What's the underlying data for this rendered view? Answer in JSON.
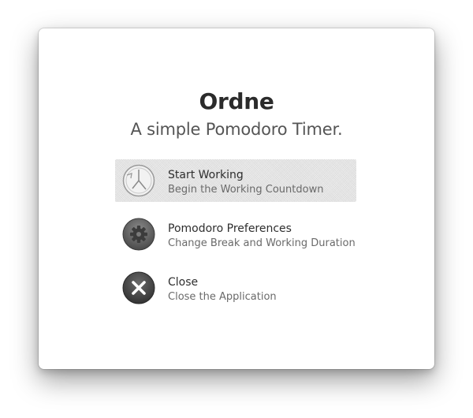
{
  "app": {
    "title": "Ordne",
    "subtitle": "A simple Pomodoro Timer."
  },
  "menu": {
    "items": [
      {
        "label": "Start Working",
        "description": "Begin the Working Countdown",
        "icon": "timer-icon",
        "selected": true
      },
      {
        "label": "Pomodoro Preferences",
        "description": "Change Break and Working Duration",
        "icon": "gear-icon",
        "selected": false
      },
      {
        "label": "Close",
        "description": "Close the Application",
        "icon": "close-icon",
        "selected": false
      }
    ]
  }
}
